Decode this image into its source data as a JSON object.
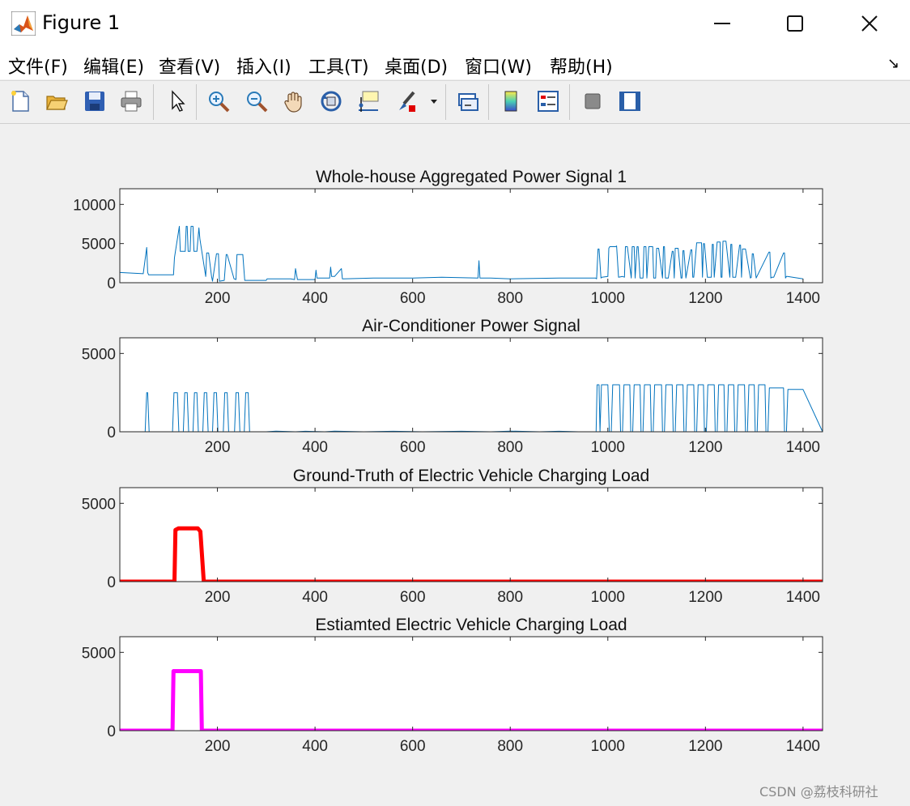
{
  "window": {
    "title": "Figure 1"
  },
  "menu": [
    {
      "label": "文件(F)"
    },
    {
      "label": "编辑(E)"
    },
    {
      "label": "查看(V)"
    },
    {
      "label": "插入(I)"
    },
    {
      "label": "工具(T)"
    },
    {
      "label": "桌面(D)"
    },
    {
      "label": "窗口(W)"
    },
    {
      "label": "帮助(H)"
    }
  ],
  "toolbar": [
    {
      "icon": "new-figure-icon"
    },
    {
      "icon": "open-file-icon"
    },
    {
      "icon": "save-icon"
    },
    {
      "icon": "print-icon"
    },
    {
      "icon": "pointer-icon"
    },
    {
      "icon": "zoom-in-icon"
    },
    {
      "icon": "zoom-out-icon"
    },
    {
      "icon": "pan-hand-icon"
    },
    {
      "icon": "rotate-3d-icon"
    },
    {
      "icon": "data-cursor-icon"
    },
    {
      "icon": "brush-icon"
    },
    {
      "icon": "link-plot-icon"
    },
    {
      "icon": "colorbar-icon"
    },
    {
      "icon": "legend-icon"
    },
    {
      "icon": "hide-plot-tools-icon"
    },
    {
      "icon": "show-plot-tools-icon"
    }
  ],
  "watermark": "CSDN @荔枝科研社",
  "chart_data": [
    {
      "type": "line",
      "title": "Whole-house Aggregated Power Signal 1",
      "xlim": [
        0,
        1440
      ],
      "ylim": [
        0,
        12000
      ],
      "xticks": [
        200,
        400,
        600,
        800,
        1000,
        1200,
        1400
      ],
      "yticks": [
        0,
        5000,
        10000
      ],
      "ytick_labels": [
        "0",
        "5000",
        "10000"
      ],
      "grid": false,
      "color": "#0072bd",
      "x": [
        0,
        48,
        55,
        57,
        59,
        62,
        110,
        112,
        122,
        124,
        134,
        136,
        138,
        140,
        144,
        146,
        150,
        152,
        158,
        162,
        164,
        176,
        178,
        182,
        188,
        190,
        198,
        202,
        204,
        214,
        218,
        220,
        234,
        238,
        240,
        252,
        256,
        258,
        300,
        302,
        350,
        358,
        360,
        364,
        400,
        402,
        404,
        430,
        432,
        434,
        440,
        454,
        456,
        458,
        520,
        600,
        660,
        734,
        736,
        738,
        760,
        800,
        900,
        975,
        977,
        980,
        982,
        986,
        988,
        1000,
        1002,
        1004,
        1010,
        1016,
        1018,
        1022,
        1030,
        1034,
        1036,
        1040,
        1048,
        1050,
        1054,
        1056,
        1060,
        1062,
        1066,
        1072,
        1074,
        1078,
        1080,
        1084,
        1092,
        1094,
        1098,
        1100,
        1104,
        1112,
        1114,
        1116,
        1118,
        1124,
        1132,
        1134,
        1136,
        1138,
        1144,
        1150,
        1152,
        1154,
        1156,
        1160,
        1170,
        1172,
        1174,
        1176,
        1182,
        1192,
        1194,
        1196,
        1198,
        1204,
        1212,
        1214,
        1216,
        1218,
        1224,
        1230,
        1232,
        1234,
        1236,
        1242,
        1250,
        1252,
        1254,
        1256,
        1262,
        1270,
        1272,
        1274,
        1276,
        1282,
        1292,
        1294,
        1296,
        1298,
        1304,
        1330,
        1332,
        1334,
        1336,
        1340,
        1360,
        1362,
        1364,
        1366,
        1368,
        1400,
        1440
      ],
      "y": [
        1300,
        1150,
        4500,
        1300,
        1000,
        1000,
        1000,
        3200,
        7200,
        4000,
        4000,
        7200,
        7200,
        4000,
        4000,
        7200,
        7200,
        4000,
        4000,
        7000,
        5600,
        800,
        3800,
        3800,
        800,
        200,
        3700,
        3700,
        200,
        300,
        3600,
        3600,
        500,
        400,
        3600,
        3600,
        300,
        300,
        300,
        500,
        500,
        400,
        1800,
        400,
        400,
        1600,
        600,
        600,
        2000,
        800,
        800,
        1800,
        500,
        500,
        600,
        600,
        700,
        600,
        2800,
        600,
        600,
        500,
        600,
        600,
        500,
        4300,
        4300,
        600,
        700,
        800,
        4400,
        4600,
        4600,
        4600,
        4700,
        700,
        800,
        700,
        4600,
        4600,
        600,
        4600,
        4600,
        600,
        4600,
        4600,
        600,
        600,
        4600,
        4600,
        600,
        4600,
        4600,
        600,
        600,
        4400,
        4400,
        600,
        4600,
        4600,
        600,
        600,
        4000,
        4000,
        600,
        4400,
        4400,
        600,
        600,
        4100,
        4100,
        600,
        4200,
        4200,
        700,
        700,
        5100,
        5100,
        700,
        5000,
        5000,
        700,
        700,
        4900,
        4900,
        700,
        5200,
        5200,
        700,
        700,
        5300,
        5300,
        700,
        4900,
        4900,
        700,
        700,
        4800,
        4800,
        700,
        4300,
        4300,
        600,
        700,
        3700,
        3700,
        600,
        3900,
        3900,
        600,
        700,
        700,
        3800,
        3800,
        600,
        800,
        800,
        500
      ]
    },
    {
      "type": "line",
      "title": "Air-Conditioner Power Signal",
      "xlim": [
        0,
        1440
      ],
      "ylim": [
        0,
        6000
      ],
      "xticks": [
        200,
        400,
        600,
        800,
        1000,
        1200,
        1400
      ],
      "yticks": [
        0,
        5000
      ],
      "ytick_labels": [
        "0",
        "5000"
      ],
      "grid": false,
      "color": "#0072bd",
      "x": [
        0,
        52,
        55,
        57,
        60,
        108,
        111,
        118,
        121,
        130,
        133,
        138,
        141,
        150,
        153,
        158,
        161,
        170,
        173,
        178,
        181,
        190,
        193,
        198,
        201,
        212,
        215,
        220,
        223,
        235,
        238,
        243,
        246,
        255,
        258,
        263,
        266,
        300,
        320,
        360,
        380,
        420,
        440,
        500,
        560,
        620,
        700,
        760,
        800,
        860,
        900,
        940,
        976,
        978,
        982,
        984,
        987,
        1000,
        1003,
        1007,
        1010,
        1024,
        1026,
        1030,
        1033,
        1045,
        1047,
        1051,
        1054,
        1066,
        1068,
        1072,
        1075,
        1087,
        1089,
        1093,
        1096,
        1110,
        1112,
        1116,
        1119,
        1132,
        1134,
        1138,
        1141,
        1154,
        1156,
        1160,
        1163,
        1176,
        1178,
        1182,
        1185,
        1196,
        1198,
        1202,
        1205,
        1218,
        1220,
        1224,
        1227,
        1238,
        1240,
        1244,
        1247,
        1258,
        1260,
        1264,
        1267,
        1280,
        1282,
        1286,
        1289,
        1300,
        1302,
        1306,
        1309,
        1322,
        1324,
        1328,
        1331,
        1360,
        1362,
        1366,
        1369,
        1400,
        1440
      ],
      "y": [
        0,
        0,
        2500,
        2500,
        0,
        0,
        2500,
        2500,
        0,
        0,
        2500,
        2500,
        0,
        0,
        2500,
        2500,
        0,
        0,
        2500,
        2500,
        0,
        0,
        2500,
        2500,
        0,
        0,
        2500,
        2500,
        0,
        0,
        2500,
        2500,
        0,
        0,
        2500,
        2500,
        0,
        0,
        40,
        0,
        30,
        0,
        40,
        0,
        30,
        0,
        30,
        0,
        40,
        0,
        30,
        0,
        0,
        3000,
        3000,
        0,
        3000,
        3000,
        0,
        0,
        3000,
        3000,
        0,
        0,
        3000,
        3000,
        0,
        0,
        3000,
        3000,
        0,
        0,
        3000,
        3000,
        0,
        0,
        3000,
        3000,
        0,
        0,
        3000,
        3000,
        0,
        0,
        3000,
        3000,
        0,
        0,
        3000,
        3000,
        0,
        0,
        3000,
        3000,
        0,
        0,
        3000,
        3000,
        0,
        0,
        3000,
        3000,
        0,
        0,
        3000,
        3000,
        0,
        0,
        3000,
        3000,
        0,
        0,
        3000,
        3000,
        0,
        0,
        3000,
        3000,
        0,
        0,
        2800,
        2800,
        0,
        0,
        2700,
        2700,
        0,
        0,
        0
      ]
    },
    {
      "type": "line",
      "title": "Ground-Truth of Electric Vehicle Charging Load",
      "xlim": [
        0,
        1440
      ],
      "ylim": [
        0,
        6000
      ],
      "xticks": [
        200,
        400,
        600,
        800,
        1000,
        1200,
        1400
      ],
      "yticks": [
        0,
        5000
      ],
      "ytick_labels": [
        "0",
        "5000"
      ],
      "grid": false,
      "color": "#ff0000",
      "x": [
        0,
        112,
        114,
        120,
        160,
        165,
        172,
        174,
        1440
      ],
      "y": [
        0,
        0,
        3300,
        3400,
        3400,
        3200,
        0,
        0,
        0
      ]
    },
    {
      "type": "line",
      "title": "Estiamted Electric Vehicle Charging Load",
      "xlim": [
        0,
        1440
      ],
      "ylim": [
        0,
        6000
      ],
      "xticks": [
        200,
        400,
        600,
        800,
        1000,
        1200,
        1400
      ],
      "yticks": [
        0,
        5000
      ],
      "ytick_labels": [
        "0",
        "5000"
      ],
      "grid": false,
      "color": "#ff00ff",
      "x": [
        0,
        108,
        110,
        166,
        168,
        1440
      ],
      "y": [
        0,
        0,
        3800,
        3800,
        0,
        0
      ]
    }
  ]
}
